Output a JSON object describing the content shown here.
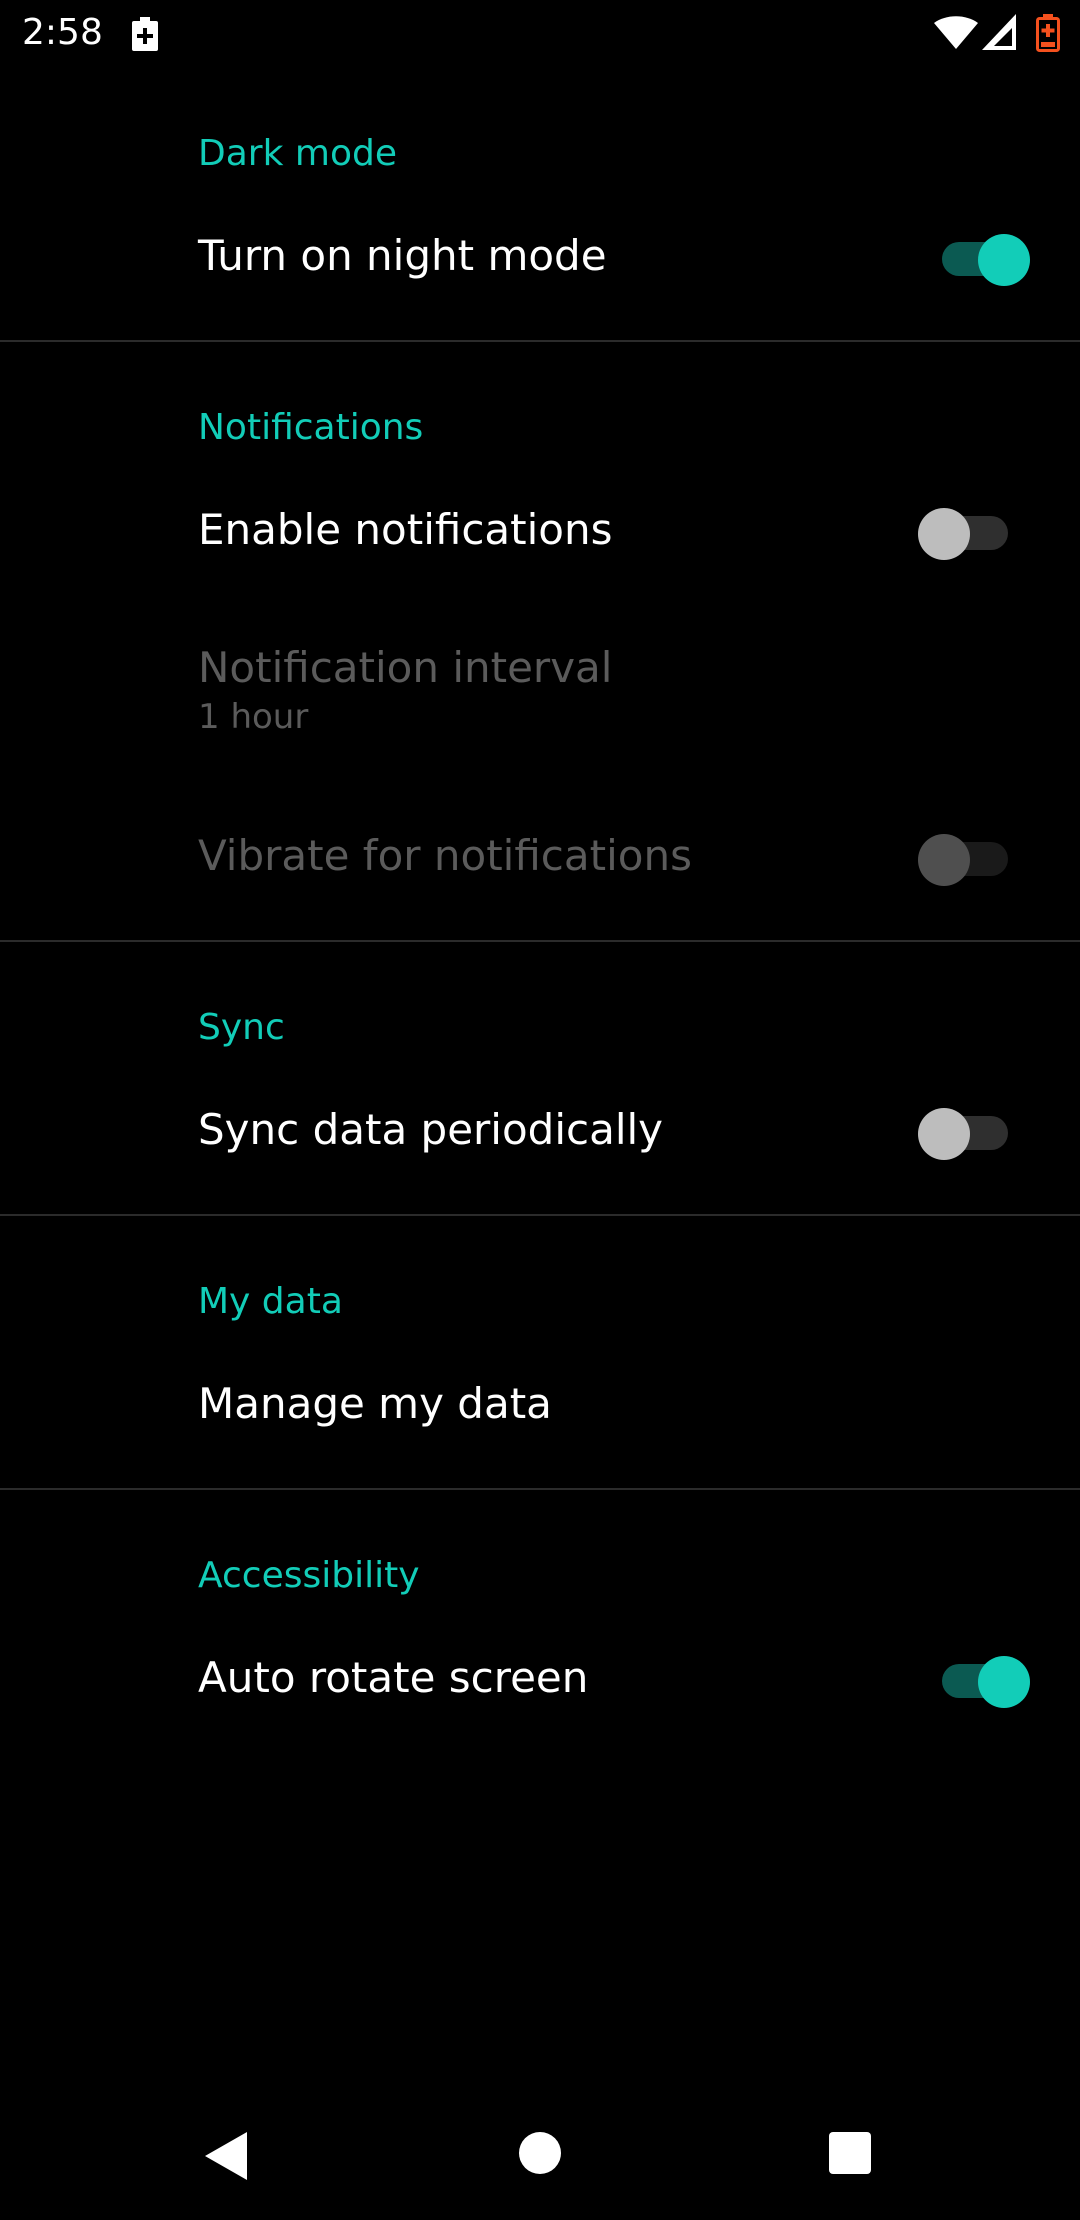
{
  "status_bar": {
    "time": "2:58",
    "icons": [
      "battery-saver-icon",
      "wifi-icon",
      "signal-icon",
      "battery-icon"
    ]
  },
  "colors": {
    "accent": "#12cdb8",
    "background": "#000000",
    "disabled_text": "#5b5b5b"
  },
  "sections": {
    "dark_mode": {
      "title": "Dark mode",
      "night_mode": {
        "label": "Turn on night mode",
        "checked": true
      }
    },
    "notifications": {
      "title": "Notifications",
      "enable": {
        "label": "Enable notifications",
        "checked": false
      },
      "interval": {
        "label": "Notification interval",
        "summary": "1 hour",
        "enabled": false
      },
      "vibrate": {
        "label": "Vibrate for notifications",
        "checked": false,
        "enabled": false
      }
    },
    "sync": {
      "title": "Sync",
      "periodic": {
        "label": "Sync data periodically",
        "checked": false
      }
    },
    "my_data": {
      "title": "My data",
      "manage": {
        "label": "Manage my data"
      }
    },
    "accessibility": {
      "title": "Accessibility",
      "auto_rotate": {
        "label": "Auto rotate screen",
        "checked": true
      }
    }
  },
  "nav_bar": {
    "buttons": [
      "back-icon",
      "home-icon",
      "recents-icon"
    ]
  }
}
